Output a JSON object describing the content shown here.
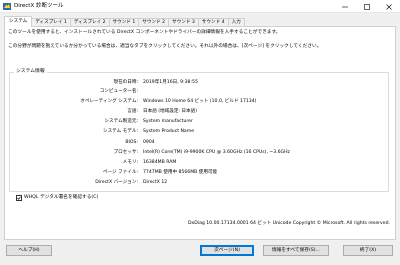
{
  "window": {
    "title": "DirectX 診断ツール"
  },
  "tabs": [
    {
      "label": "システム",
      "active": true
    },
    {
      "label": "ディスプレイ 1"
    },
    {
      "label": "ディスプレイ 2"
    },
    {
      "label": "サウンド 1"
    },
    {
      "label": "サウンド 2"
    },
    {
      "label": "サウンド 3"
    },
    {
      "label": "サウンド 4"
    },
    {
      "label": "入力"
    }
  ],
  "intro": {
    "line1": "このツールを使用すると、インストールされている DirectX コンポーネントやドライバーの詳細情報を入手することができます。",
    "line2": "この分野が問題を抱えているか分かっている場合は、適当なタブをクリックしてください。それ以外の場合は、[次ページ] をクリックしてください。"
  },
  "system_info": {
    "group_title": "システム情報",
    "rows": [
      {
        "label": "現在の日時:",
        "value": "2019年1月16日, 9:38:55"
      },
      {
        "label": "コンピューター名:",
        "value": ""
      },
      {
        "label": "オペレーティング システム:",
        "value": "Windows 10 Home 64 ビット (10.0, ビルド 17134)"
      },
      {
        "label": "言語:",
        "value": "日本語 (地域設定: 日本語)"
      },
      {
        "label": "システム製造元:",
        "value": "System manufacturer"
      },
      {
        "label": "システム モデル:",
        "value": "System Product Name"
      },
      {
        "label": "BIOS:",
        "value": "0904"
      },
      {
        "label": "プロセッサ:",
        "value": "Intel(R) Core(TM) i9-9900K CPU @ 3.60GHz (16 CPUs), ~3.6GHz"
      },
      {
        "label": "メモリ:",
        "value": "16384MB RAM"
      },
      {
        "label": "ページ ファイル:",
        "value": "7747MB 使用中 8566MB 使用可能"
      },
      {
        "label": "DirectX バージョン:",
        "value": "DirectX 12"
      }
    ]
  },
  "whql": {
    "label": "WHQL デジタル署名を確認する(C)",
    "checked": true
  },
  "version_text": "DxDiag 10.00.17134.0001 64 ビット Unicode  Copyright © Microsoft. All rights reserved.",
  "buttons": {
    "help": "ヘルプ(H)",
    "next": "次ページ(N)",
    "save": "情報をすべて保存(S)...",
    "exit": "終了(X)"
  },
  "colors": {
    "accent": "#0078d7",
    "window_bg": "#f0f0f0",
    "panel_bg": "#ffffff"
  },
  "icons": [
    "directx-app-icon",
    "minimize-icon",
    "maximize-icon",
    "close-icon",
    "checkmark-icon"
  ]
}
